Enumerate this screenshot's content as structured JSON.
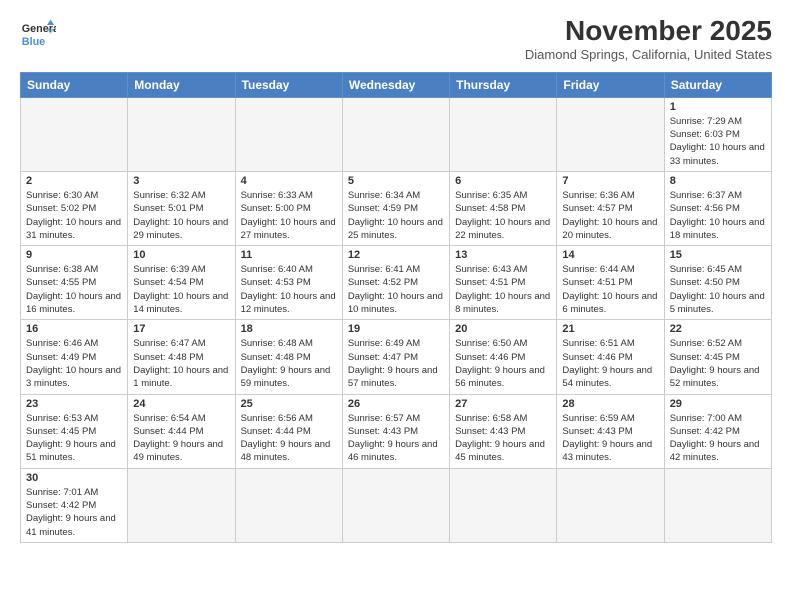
{
  "header": {
    "logo_general": "General",
    "logo_blue": "Blue",
    "month_year": "November 2025",
    "location": "Diamond Springs, California, United States"
  },
  "days_of_week": [
    "Sunday",
    "Monday",
    "Tuesday",
    "Wednesday",
    "Thursday",
    "Friday",
    "Saturday"
  ],
  "weeks": [
    [
      {
        "day": "",
        "info": ""
      },
      {
        "day": "",
        "info": ""
      },
      {
        "day": "",
        "info": ""
      },
      {
        "day": "",
        "info": ""
      },
      {
        "day": "",
        "info": ""
      },
      {
        "day": "",
        "info": ""
      },
      {
        "day": "1",
        "info": "Sunrise: 7:29 AM\nSunset: 6:03 PM\nDaylight: 10 hours and 33 minutes."
      }
    ],
    [
      {
        "day": "2",
        "info": "Sunrise: 6:30 AM\nSunset: 5:02 PM\nDaylight: 10 hours and 31 minutes."
      },
      {
        "day": "3",
        "info": "Sunrise: 6:32 AM\nSunset: 5:01 PM\nDaylight: 10 hours and 29 minutes."
      },
      {
        "day": "4",
        "info": "Sunrise: 6:33 AM\nSunset: 5:00 PM\nDaylight: 10 hours and 27 minutes."
      },
      {
        "day": "5",
        "info": "Sunrise: 6:34 AM\nSunset: 4:59 PM\nDaylight: 10 hours and 25 minutes."
      },
      {
        "day": "6",
        "info": "Sunrise: 6:35 AM\nSunset: 4:58 PM\nDaylight: 10 hours and 22 minutes."
      },
      {
        "day": "7",
        "info": "Sunrise: 6:36 AM\nSunset: 4:57 PM\nDaylight: 10 hours and 20 minutes."
      },
      {
        "day": "8",
        "info": "Sunrise: 6:37 AM\nSunset: 4:56 PM\nDaylight: 10 hours and 18 minutes."
      }
    ],
    [
      {
        "day": "9",
        "info": "Sunrise: 6:38 AM\nSunset: 4:55 PM\nDaylight: 10 hours and 16 minutes."
      },
      {
        "day": "10",
        "info": "Sunrise: 6:39 AM\nSunset: 4:54 PM\nDaylight: 10 hours and 14 minutes."
      },
      {
        "day": "11",
        "info": "Sunrise: 6:40 AM\nSunset: 4:53 PM\nDaylight: 10 hours and 12 minutes."
      },
      {
        "day": "12",
        "info": "Sunrise: 6:41 AM\nSunset: 4:52 PM\nDaylight: 10 hours and 10 minutes."
      },
      {
        "day": "13",
        "info": "Sunrise: 6:43 AM\nSunset: 4:51 PM\nDaylight: 10 hours and 8 minutes."
      },
      {
        "day": "14",
        "info": "Sunrise: 6:44 AM\nSunset: 4:51 PM\nDaylight: 10 hours and 6 minutes."
      },
      {
        "day": "15",
        "info": "Sunrise: 6:45 AM\nSunset: 4:50 PM\nDaylight: 10 hours and 5 minutes."
      }
    ],
    [
      {
        "day": "16",
        "info": "Sunrise: 6:46 AM\nSunset: 4:49 PM\nDaylight: 10 hours and 3 minutes."
      },
      {
        "day": "17",
        "info": "Sunrise: 6:47 AM\nSunset: 4:48 PM\nDaylight: 10 hours and 1 minute."
      },
      {
        "day": "18",
        "info": "Sunrise: 6:48 AM\nSunset: 4:48 PM\nDaylight: 9 hours and 59 minutes."
      },
      {
        "day": "19",
        "info": "Sunrise: 6:49 AM\nSunset: 4:47 PM\nDaylight: 9 hours and 57 minutes."
      },
      {
        "day": "20",
        "info": "Sunrise: 6:50 AM\nSunset: 4:46 PM\nDaylight: 9 hours and 56 minutes."
      },
      {
        "day": "21",
        "info": "Sunrise: 6:51 AM\nSunset: 4:46 PM\nDaylight: 9 hours and 54 minutes."
      },
      {
        "day": "22",
        "info": "Sunrise: 6:52 AM\nSunset: 4:45 PM\nDaylight: 9 hours and 52 minutes."
      }
    ],
    [
      {
        "day": "23",
        "info": "Sunrise: 6:53 AM\nSunset: 4:45 PM\nDaylight: 9 hours and 51 minutes."
      },
      {
        "day": "24",
        "info": "Sunrise: 6:54 AM\nSunset: 4:44 PM\nDaylight: 9 hours and 49 minutes."
      },
      {
        "day": "25",
        "info": "Sunrise: 6:56 AM\nSunset: 4:44 PM\nDaylight: 9 hours and 48 minutes."
      },
      {
        "day": "26",
        "info": "Sunrise: 6:57 AM\nSunset: 4:43 PM\nDaylight: 9 hours and 46 minutes."
      },
      {
        "day": "27",
        "info": "Sunrise: 6:58 AM\nSunset: 4:43 PM\nDaylight: 9 hours and 45 minutes."
      },
      {
        "day": "28",
        "info": "Sunrise: 6:59 AM\nSunset: 4:43 PM\nDaylight: 9 hours and 43 minutes."
      },
      {
        "day": "29",
        "info": "Sunrise: 7:00 AM\nSunset: 4:42 PM\nDaylight: 9 hours and 42 minutes."
      }
    ],
    [
      {
        "day": "30",
        "info": "Sunrise: 7:01 AM\nSunset: 4:42 PM\nDaylight: 9 hours and 41 minutes."
      },
      {
        "day": "",
        "info": ""
      },
      {
        "day": "",
        "info": ""
      },
      {
        "day": "",
        "info": ""
      },
      {
        "day": "",
        "info": ""
      },
      {
        "day": "",
        "info": ""
      },
      {
        "day": "",
        "info": ""
      }
    ]
  ]
}
